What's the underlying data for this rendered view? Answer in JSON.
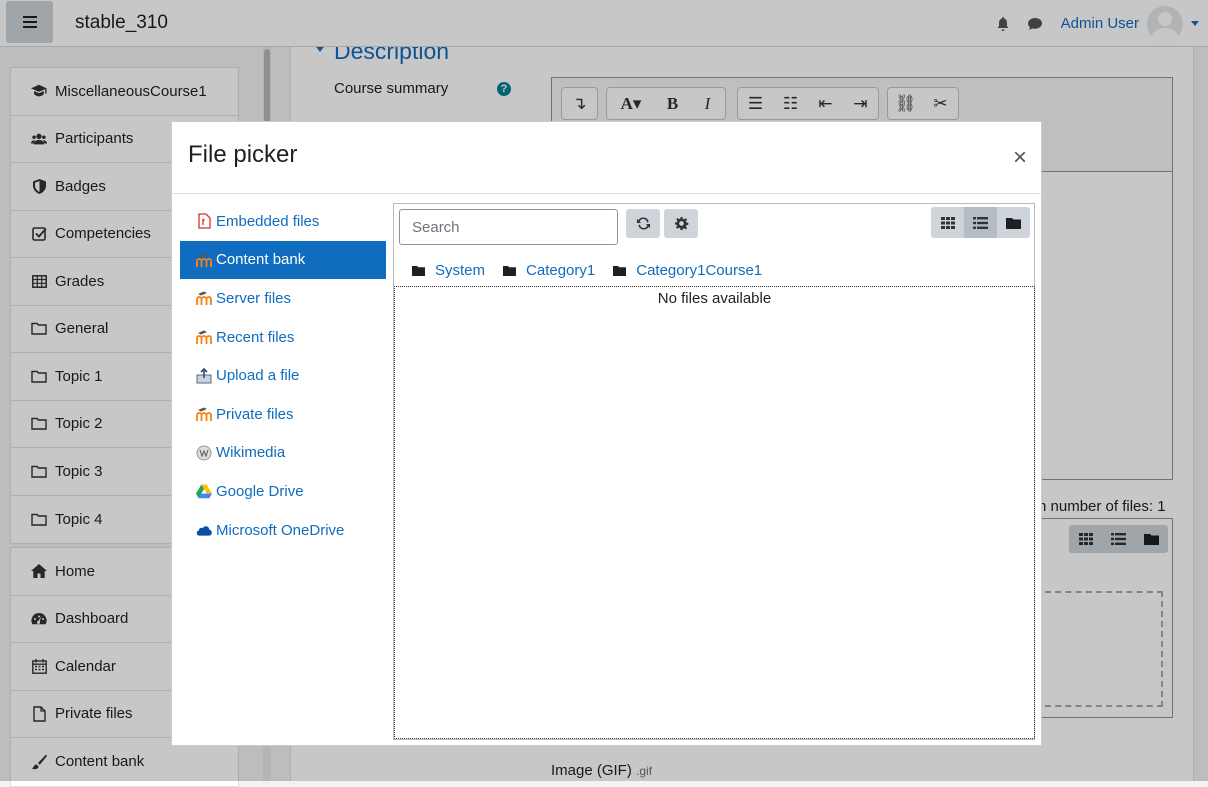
{
  "navbar": {
    "site_name": "stable_310",
    "user_name": "Admin User"
  },
  "drawer": {
    "course_items": [
      {
        "label": "MiscellaneousCourse1",
        "icon": "graduation-cap-icon"
      },
      {
        "label": "Participants",
        "icon": "users-icon"
      },
      {
        "label": "Badges",
        "icon": "shield-icon"
      },
      {
        "label": "Competencies",
        "icon": "check-square-icon"
      },
      {
        "label": "Grades",
        "icon": "table-icon"
      },
      {
        "label": "General",
        "icon": "folder-icon"
      },
      {
        "label": "Topic 1",
        "icon": "folder-icon"
      },
      {
        "label": "Topic 2",
        "icon": "folder-icon"
      },
      {
        "label": "Topic 3",
        "icon": "folder-icon"
      },
      {
        "label": "Topic 4",
        "icon": "folder-icon"
      }
    ],
    "site_items": [
      {
        "label": "Home",
        "icon": "home-icon"
      },
      {
        "label": "Dashboard",
        "icon": "dashboard-icon"
      },
      {
        "label": "Calendar",
        "icon": "calendar-icon"
      },
      {
        "label": "Private files",
        "icon": "file-icon"
      },
      {
        "label": "Content bank",
        "icon": "paintbrush-icon"
      }
    ]
  },
  "page": {
    "section_title": "Description",
    "field_label": "Course summary",
    "help_icon": "?",
    "files_limit_text": "n number of files: 1",
    "image_type_label": "Image (GIF)",
    "image_type_ext": ".gif"
  },
  "modal": {
    "title": "File picker",
    "close_label": "×",
    "repositories": [
      {
        "label": "Embedded files",
        "icon": "embedded-files-icon",
        "active": false
      },
      {
        "label": "Content bank",
        "icon": "moodle-icon",
        "active": true
      },
      {
        "label": "Server files",
        "icon": "moodle-icon",
        "active": false
      },
      {
        "label": "Recent files",
        "icon": "moodle-icon",
        "active": false
      },
      {
        "label": "Upload a file",
        "icon": "upload-icon",
        "active": false
      },
      {
        "label": "Private files",
        "icon": "moodle-icon",
        "active": false
      },
      {
        "label": "Wikimedia",
        "icon": "wikimedia-icon",
        "active": false
      },
      {
        "label": "Google Drive",
        "icon": "google-drive-icon",
        "active": false
      },
      {
        "label": "Microsoft OneDrive",
        "icon": "onedrive-icon",
        "active": false
      }
    ],
    "search_placeholder": "Search",
    "path": [
      "System",
      "Category1",
      "Category1Course1"
    ],
    "empty_message": "No files available",
    "active_view": "list"
  }
}
